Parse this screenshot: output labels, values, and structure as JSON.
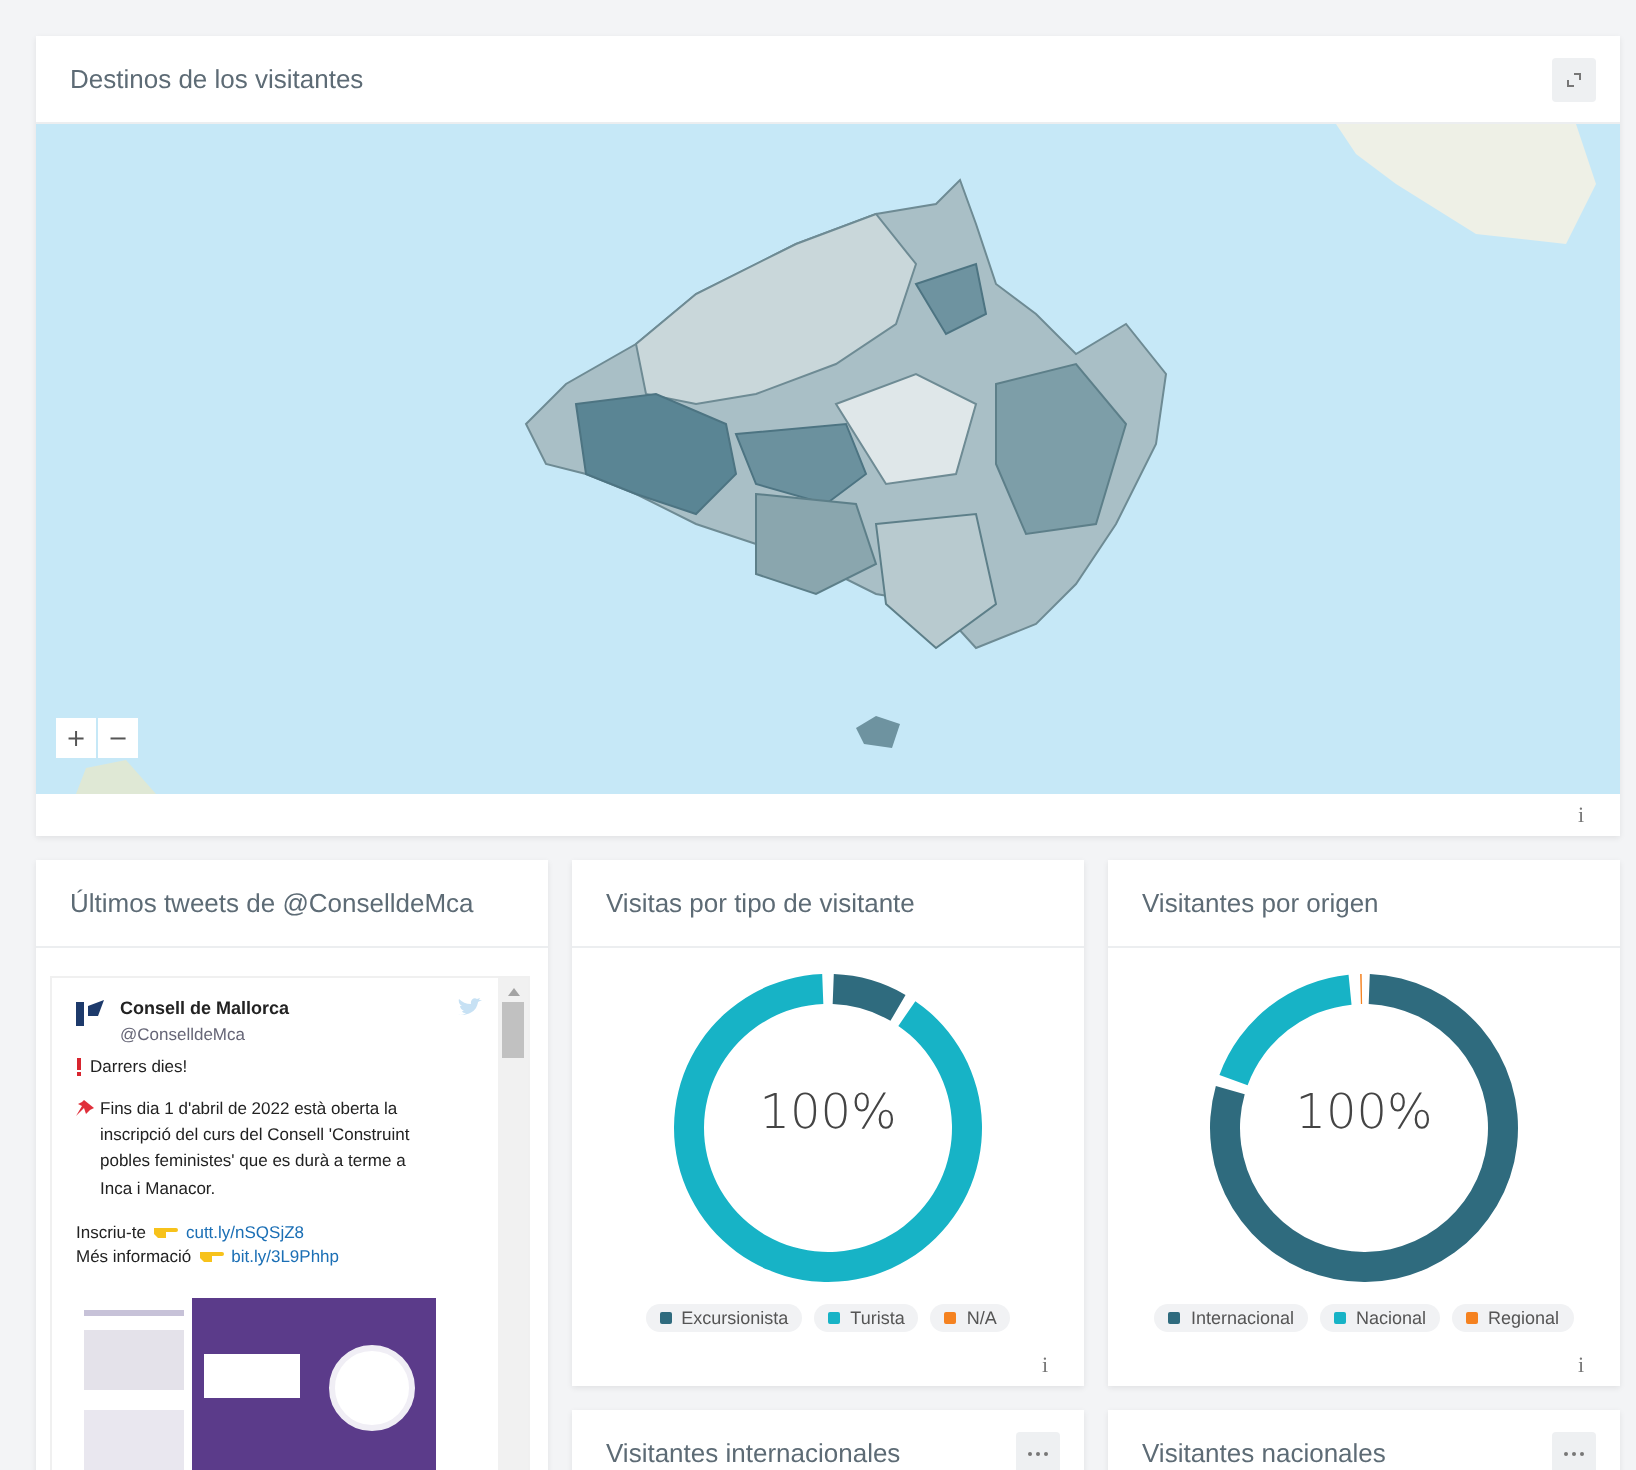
{
  "map_card": {
    "title": "Destinos de los visitantes",
    "zoom_in": "+",
    "zoom_out": "−",
    "info": "i"
  },
  "tweets_card": {
    "title": "Últimos tweets de @ConselldeMca",
    "tweet": {
      "author": "Consell de Mallorca",
      "handle": "@ConselldeMca",
      "headline": "Darrers dies!",
      "body": "Fins dia 1 d'abril de 2022 està oberta la inscripció del curs del Consell 'Construint pobles feministes' que es durà a terme a Inca i Manacor.",
      "links": [
        {
          "label": "Inscriu-te",
          "url": "cutt.ly/nSQSjZ8"
        },
        {
          "label": "Més informació",
          "url": "bit.ly/3L9Phhp"
        }
      ]
    }
  },
  "donut_cards": [
    {
      "center": "100%",
      "info": "i",
      "chart_data": {
        "type": "donut",
        "title": "Visitas por tipo de visitante",
        "categories": [
          "Excursionista",
          "Turista",
          "N/A"
        ],
        "colors": [
          "#2f6b7e",
          "#17b3c6",
          "#f58220"
        ],
        "series": [
          {
            "values": [
              0.09,
              0.91,
              0
            ]
          }
        ]
      }
    },
    {
      "center": "100%",
      "info": "i",
      "chart_data": {
        "type": "donut",
        "title": "Visitantes por origen",
        "categories": [
          "Internacional",
          "Nacional",
          "Regional"
        ],
        "colors": [
          "#2f6b7e",
          "#17b3c6",
          "#f58220"
        ],
        "series": [
          {
            "values": [
              0.8,
              0.19,
              0.01
            ]
          }
        ]
      }
    }
  ],
  "bottom_cards": [
    {
      "title": "Visitantes internacionales"
    },
    {
      "title": "Visitantes nacionales"
    }
  ]
}
